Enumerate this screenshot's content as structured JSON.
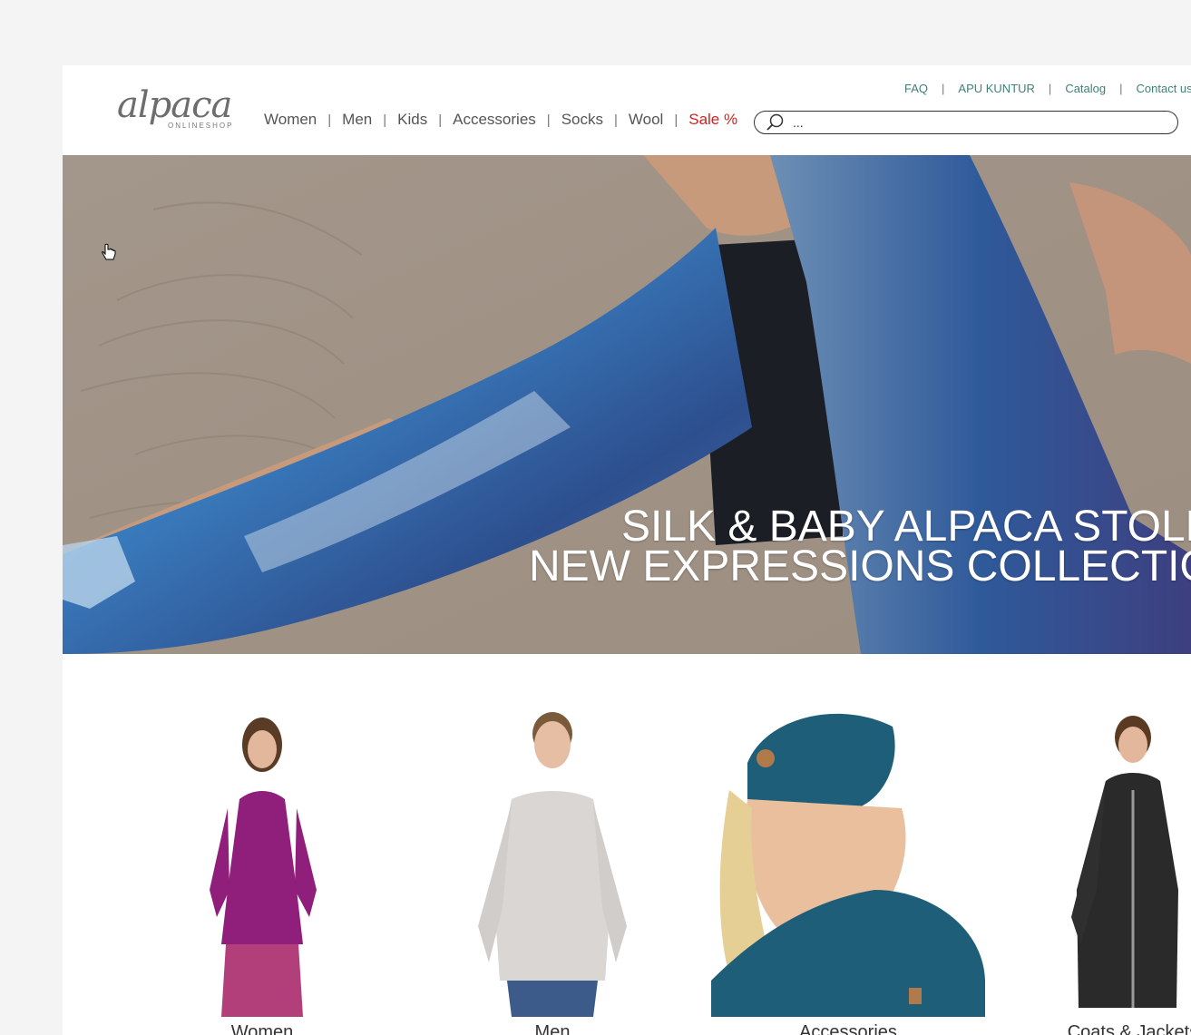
{
  "brand": {
    "logo_word": "alpaca",
    "logo_sub": "ONLINESHOP"
  },
  "nav": {
    "items": [
      "Women",
      "Men",
      "Kids",
      "Accessories",
      "Socks",
      "Wool",
      "Sale %"
    ],
    "separator": "|"
  },
  "toplinks": {
    "items": [
      "FAQ",
      "APU KUNTUR",
      "Catalog",
      "Contact us"
    ],
    "separator": "|"
  },
  "search": {
    "value": "..."
  },
  "hero": {
    "line1": "SILK & BABY ALPACA STOLE",
    "line2": "NEW EXPRESSIONS COLLECTION"
  },
  "categories": [
    "Women",
    "Men",
    "Accessories",
    "Coats & Jackets"
  ],
  "colors": {
    "sale": "#d11f1f",
    "toplink": "#3f8079",
    "nav": "#555555"
  }
}
